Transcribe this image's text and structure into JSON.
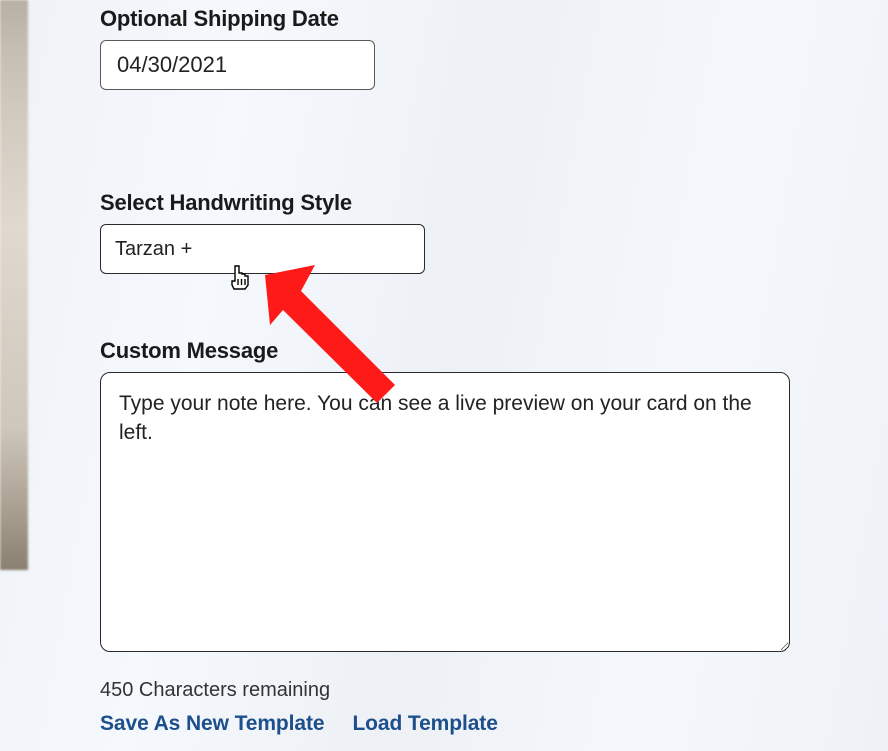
{
  "shipping": {
    "label": "Optional Shipping Date",
    "value": "04/30/2021"
  },
  "handwriting": {
    "label": "Select Handwriting Style",
    "selected": "Tarzan +"
  },
  "message": {
    "label": "Custom Message",
    "placeholder": "Type your note here. You can see a live preview on your card on the left.",
    "value": "",
    "chars_remaining_text": "450 Characters remaining"
  },
  "template_links": {
    "save": "Save As New Template",
    "load": "Load Template"
  },
  "annotation": {
    "arrow_color": "#ff1a1a"
  }
}
